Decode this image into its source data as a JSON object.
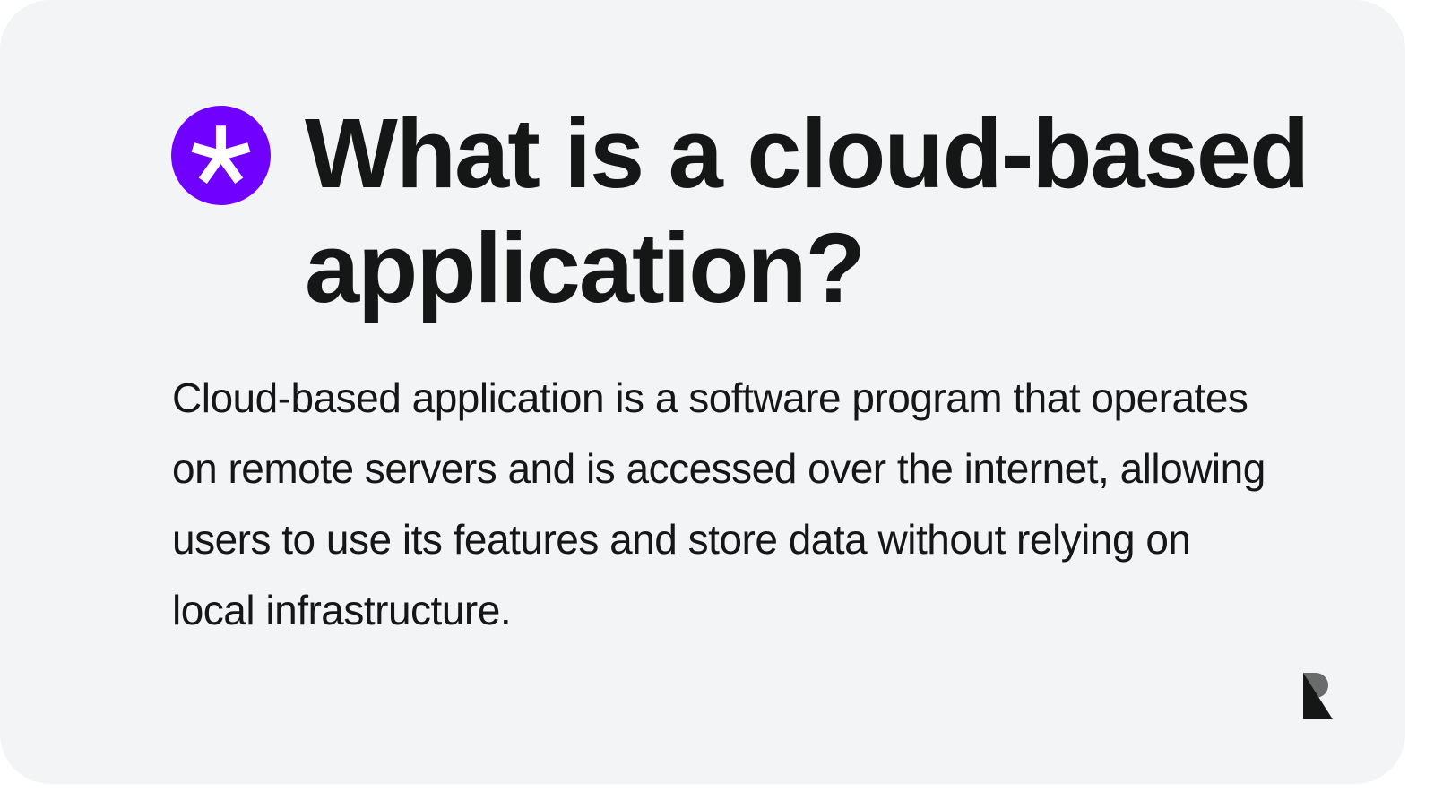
{
  "badge": {
    "icon": "asterisk-icon",
    "color": "#7000ff"
  },
  "title": "What is a cloud-based application?",
  "body": "Cloud-based application is a software program that operates on remote servers and is accessed over the internet, allowing users to use its features and store data without relying on local infrastructure.",
  "logo": {
    "letter": "R"
  }
}
